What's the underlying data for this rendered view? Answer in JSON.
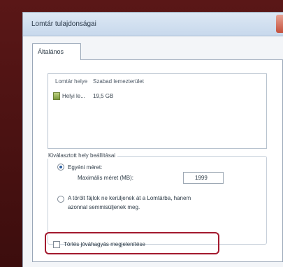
{
  "window": {
    "title": "Lomtár tulajdonságai"
  },
  "tabs": [
    {
      "label": "Általános"
    }
  ],
  "location_list": {
    "columns": [
      "Lomtár helye",
      "Szabad lemezterület"
    ],
    "rows": [
      {
        "location": "Helyi le...",
        "free_space": "19,5 GB"
      }
    ]
  },
  "settings_group": {
    "label": "Kiválasztott hely beállításai",
    "custom_size_option": "Egyéni méret:",
    "max_size_label": "Maximális méret (MB):",
    "max_size_value": "1999",
    "delete_option_line1": "A törölt fájlok ne kerüljenek át a Lomtárba, hanem",
    "delete_option_line2": "azonnal semmisüljenek meg."
  },
  "confirm_checkbox": {
    "label": "Törlés jóváhagyás megjelenítése",
    "checked": false
  },
  "colors": {
    "highlight": "#a3192e",
    "background": "#4a1212"
  }
}
